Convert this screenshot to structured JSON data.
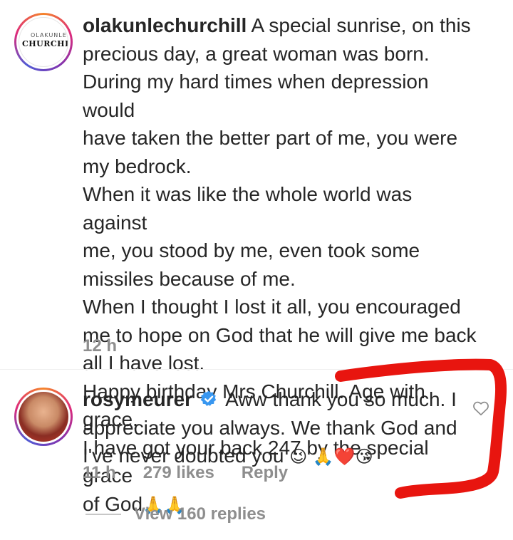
{
  "comment1": {
    "avatar_logo_small": "OLAKUNLE",
    "avatar_logo_big": "CHURCHILL",
    "username": "olakunlechurchill",
    "text": "A special sunrise, on this precious day, a great woman was born. During my hard times when depression would have taken the better part of me, you were my bedrock. When it was like the whole world was against me, you stood by me, even took some missiles because of me. When I thought I lost it all, you encouraged me to hope on God that he will give me back all I have lost. Happy birthday Mrs Churchill. Age with grace, I have got your back 247 by the special grace of God",
    "lines": [
      "A special sunrise, on this",
      "precious day, a great woman was born.",
      "During my hard times when depression would",
      "have taken the better part of me, you were",
      "my bedrock.",
      "When it was like the whole world was against",
      "me, you stood by me, even took some",
      "missiles because of me.",
      "When I thought I lost it all, you encouraged",
      "me to hope on God that he will give me back",
      "all I have lost.",
      "Happy birthday Mrs Churchill. Age with grace,",
      "I have got your back 247 by the special grace",
      "of God"
    ],
    "emojis": "🙏🙏",
    "time": "12 h"
  },
  "comment2": {
    "username": "rosymeurer",
    "lines": [
      "Aww thank you so much. I",
      "appreciate you always. We thank God and",
      "I've never doubted you"
    ],
    "emojis": "😉 🙏❤️😘",
    "time": "11 h",
    "likes": "279 likes",
    "reply": "Reply"
  },
  "view_replies": "View 160 replies",
  "colors": {
    "text": "#262626",
    "meta": "#8e8e8e",
    "verified": "#3897f0",
    "annotation": "#e8150f"
  }
}
